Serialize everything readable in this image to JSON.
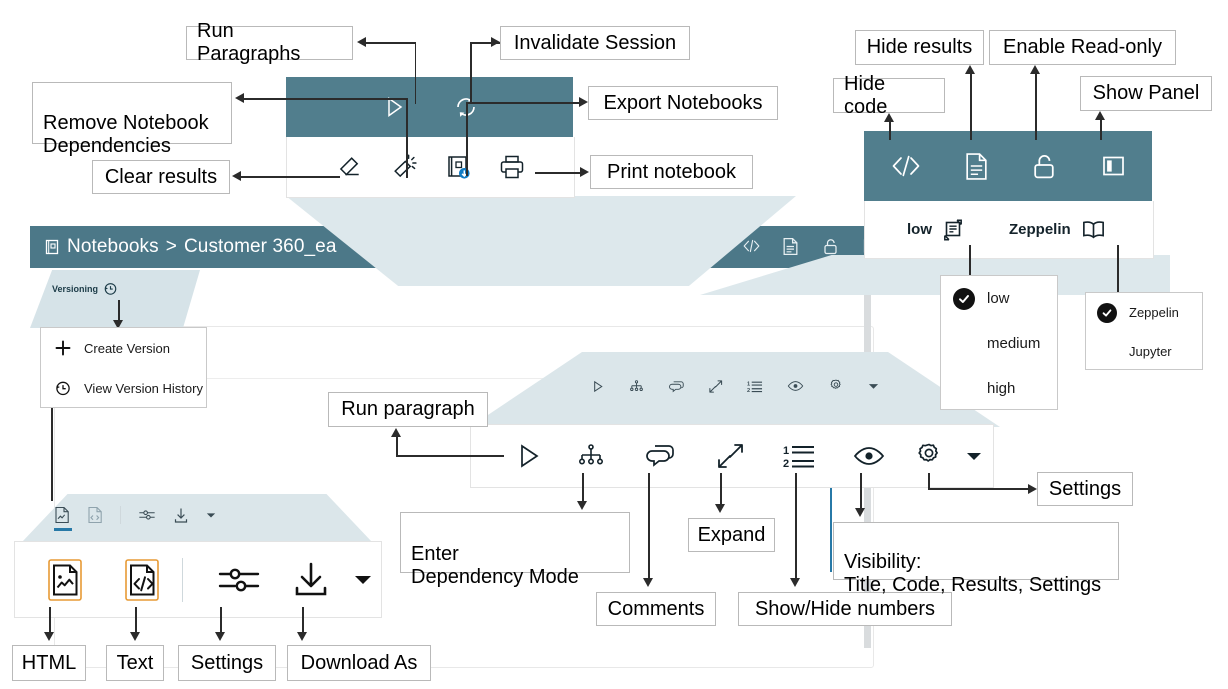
{
  "meta": {
    "accent_teal": "#517e8d",
    "accent_header": "#4c7888",
    "panel_tint": "#d6e3e8",
    "accent_blue": "#2779a7",
    "badge_blue": "#0f7bc4"
  },
  "callouts": {
    "run_paragraphs": "Run Paragraphs",
    "invalidate_session": "Invalidate Session",
    "remove_notebook_dependencies": "Remove Notebook\nDependencies",
    "export_notebooks": "Export Notebooks",
    "clear_results": "Clear results",
    "print_notebook": "Print notebook",
    "hide_code": "Hide code",
    "hide_results": "Hide results",
    "enable_read_only": "Enable Read-only",
    "show_panel": "Show Panel",
    "run_paragraph": "Run paragraph",
    "enter_dependency_mode": "Enter\nDependency Mode",
    "comments": "Comments",
    "expand": "Expand",
    "show_hide_numbers": "Show/Hide numbers",
    "visibility": "Visibility:\nTitle, Code, Results, Settings",
    "settings": "Settings",
    "html": "HTML",
    "text": "Text",
    "settings_small": "Settings",
    "download_as": "Download As"
  },
  "notebook": {
    "breadcrumb_root": "Notebooks",
    "breadcrumb_sep": ">",
    "breadcrumb_current": "Customer 360_ea",
    "versioning_label": "Versioning",
    "interpreter_label": "low",
    "editor_label": "Zeppelin"
  },
  "zoom_toolbars": {
    "notebook_toolbar_icons": [
      {
        "name": "run-paragraphs-icon",
        "glyph": "play-outline"
      },
      {
        "name": "invalidate-session-icon",
        "glyph": "refresh"
      },
      {
        "name": "clear-results-icon",
        "glyph": "eraser"
      },
      {
        "name": "remove-notebook-dependencies-icon",
        "glyph": "remove-dependency"
      },
      {
        "name": "export-notebooks-icon",
        "glyph": "export-notebook"
      },
      {
        "name": "print-notebook-icon",
        "glyph": "printer"
      }
    ],
    "view_toolbar_icons": [
      {
        "name": "hide-code-icon",
        "glyph": "code-brackets"
      },
      {
        "name": "hide-results-icon",
        "glyph": "document-lines"
      },
      {
        "name": "enable-read-only-icon",
        "glyph": "unlock"
      },
      {
        "name": "show-panel-icon",
        "glyph": "panel-split"
      }
    ],
    "paragraph_toolbar_icons": [
      {
        "name": "run-paragraph-icon",
        "glyph": "play-outline"
      },
      {
        "name": "dependency-mode-icon",
        "glyph": "hierarchy"
      },
      {
        "name": "comments-icon",
        "glyph": "speech-bubbles"
      },
      {
        "name": "expand-icon",
        "glyph": "expand-arrows"
      },
      {
        "name": "show-hide-numbers-icon",
        "glyph": "numbered-list"
      },
      {
        "name": "visibility-icon",
        "glyph": "eye"
      },
      {
        "name": "settings-icon",
        "glyph": "gear"
      },
      {
        "name": "settings-caret-icon",
        "glyph": "caret-down"
      }
    ],
    "result_toolbar_icons": [
      {
        "name": "html-icon",
        "glyph": "file-chart"
      },
      {
        "name": "text-icon",
        "glyph": "file-code"
      },
      {
        "name": "settings-icon",
        "glyph": "sliders"
      },
      {
        "name": "download-as-icon",
        "glyph": "download"
      },
      {
        "name": "download-caret-icon",
        "glyph": "caret-down"
      }
    ]
  },
  "menus": {
    "versioning": {
      "items": [
        {
          "label": "Create Version",
          "icon": "plus-icon"
        },
        {
          "label": "View Version History",
          "icon": "history-clock-icon"
        }
      ]
    },
    "interpreter": {
      "items": [
        {
          "label": "low",
          "selected": true
        },
        {
          "label": "medium",
          "selected": false
        },
        {
          "label": "high",
          "selected": false
        }
      ]
    },
    "editor": {
      "items": [
        {
          "label": "Zeppelin",
          "selected": true
        },
        {
          "label": "Jupyter",
          "selected": false
        }
      ]
    }
  }
}
